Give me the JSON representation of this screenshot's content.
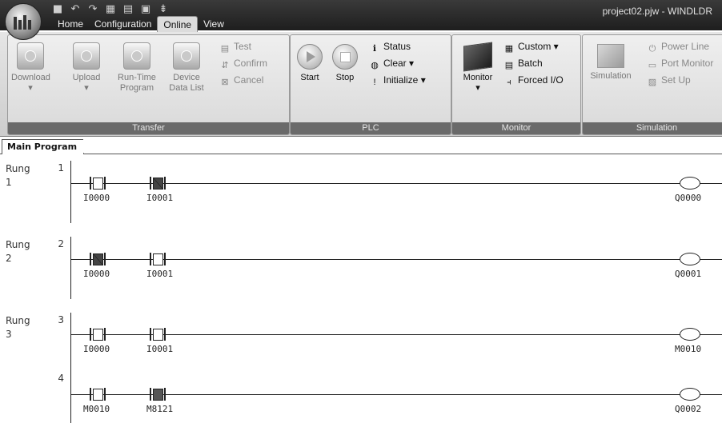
{
  "window": {
    "title": "project02.pjw - WINDLDR"
  },
  "quick_access": [
    {
      "icon": "save-icon",
      "glyph": "■"
    },
    {
      "icon": "undo-icon",
      "glyph": "↶"
    },
    {
      "icon": "redo-icon",
      "glyph": "↷"
    },
    {
      "icon": "grid-icon",
      "glyph": "▦"
    },
    {
      "icon": "tool-icon",
      "glyph": "▤"
    },
    {
      "icon": "monitor-icon",
      "glyph": "▣"
    },
    {
      "icon": "dropdown-icon",
      "glyph": "⇟"
    }
  ],
  "tabs": [
    {
      "label": "Home",
      "active": false
    },
    {
      "label": "Configuration",
      "active": false
    },
    {
      "label": "Online",
      "active": true
    },
    {
      "label": "View",
      "active": false
    }
  ],
  "ribbon": {
    "transfer": {
      "label": "Transfer",
      "download": "Download",
      "upload": "Upload",
      "runtime1": "Run-Time",
      "runtime2": "Program",
      "device1": "Device",
      "device2": "Data List",
      "test": "Test",
      "confirm": "Confirm",
      "cancel": "Cancel"
    },
    "plc": {
      "label": "PLC",
      "start": "Start",
      "stop": "Stop",
      "status": "Status",
      "clear": "Clear",
      "initialize": "Initialize"
    },
    "monitor": {
      "label": "Monitor",
      "monitor": "Monitor",
      "custom": "Custom",
      "batch": "Batch",
      "forced": "Forced I/O"
    },
    "simulation": {
      "label": "Simulation",
      "simulation": "Simulation",
      "power_line": "Power Line",
      "port_monitor": "Port Monitor",
      "setup": "Set Up"
    }
  },
  "editor": {
    "tab": "Main Program"
  },
  "rungs": [
    {
      "label": "Rung",
      "index": "1",
      "number": "1",
      "contacts": [
        {
          "device": "I0000",
          "type": "NO",
          "state": "off"
        },
        {
          "device": "I0001",
          "type": "NC",
          "state": "on"
        }
      ],
      "coil": "Q0000"
    },
    {
      "label": "Rung",
      "index": "2",
      "number": "2",
      "contacts": [
        {
          "device": "I0000",
          "type": "NC",
          "state": "on"
        },
        {
          "device": "I0001",
          "type": "NO",
          "state": "off"
        }
      ],
      "coil": "Q0001"
    },
    {
      "label": "Rung",
      "index": "3",
      "number": "3",
      "contacts": [
        {
          "device": "I0000",
          "type": "NO",
          "state": "off"
        },
        {
          "device": "I0001",
          "type": "NO",
          "state": "off"
        }
      ],
      "coil": "M0010"
    },
    {
      "label": "",
      "index": "",
      "number": "4",
      "contacts": [
        {
          "device": "M0010",
          "type": "NO",
          "state": "off"
        },
        {
          "device": "M8121",
          "type": "NO",
          "state": "on"
        }
      ],
      "coil": "Q0002"
    }
  ]
}
